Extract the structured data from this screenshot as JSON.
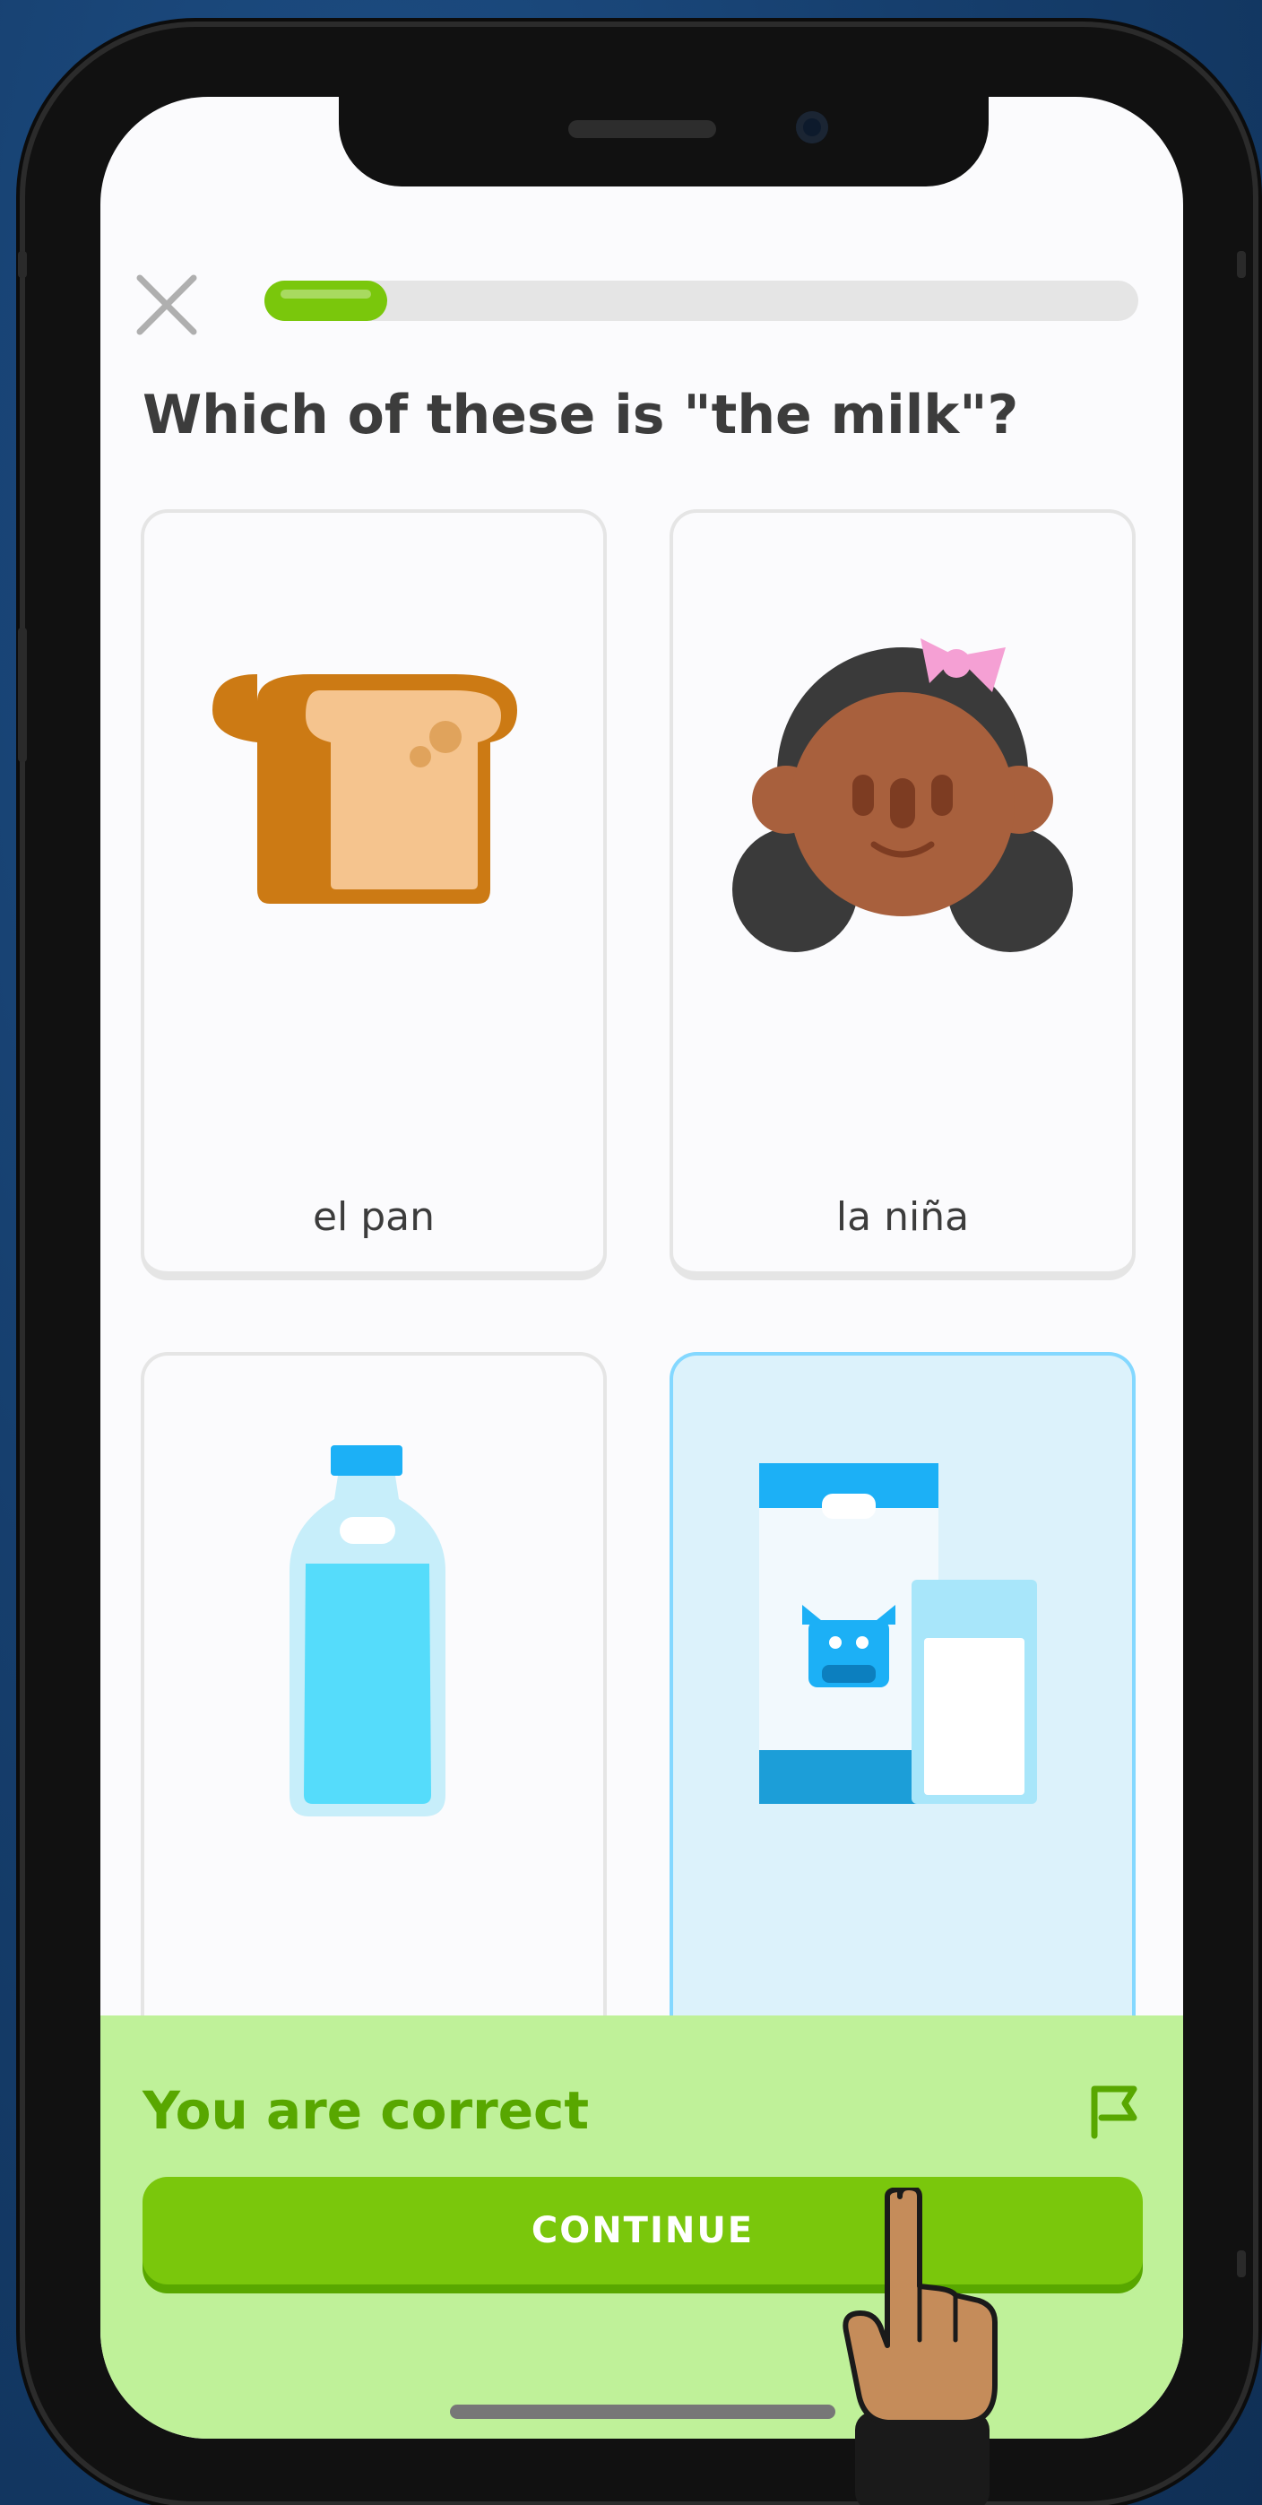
{
  "lesson": {
    "progress_fraction": 0.14,
    "question": "Which of these is \"the milk\"?"
  },
  "choices": [
    {
      "label": "el pan",
      "icon": "bread-icon",
      "selected": false
    },
    {
      "label": "la niña",
      "icon": "girl-icon",
      "selected": false
    },
    {
      "label": "",
      "icon": "water-bottle-icon",
      "selected": false
    },
    {
      "label": "",
      "icon": "milk-carton-icon",
      "selected": true
    }
  ],
  "feedback": {
    "title": "You are correct",
    "continue_label": "CONTINUE"
  },
  "colors": {
    "accent_green": "#7ac70c",
    "feedback_bg": "#bff199",
    "feedback_text": "#58a700",
    "selected_bg": "#dcf2fb",
    "selected_border": "#84d8ff"
  }
}
